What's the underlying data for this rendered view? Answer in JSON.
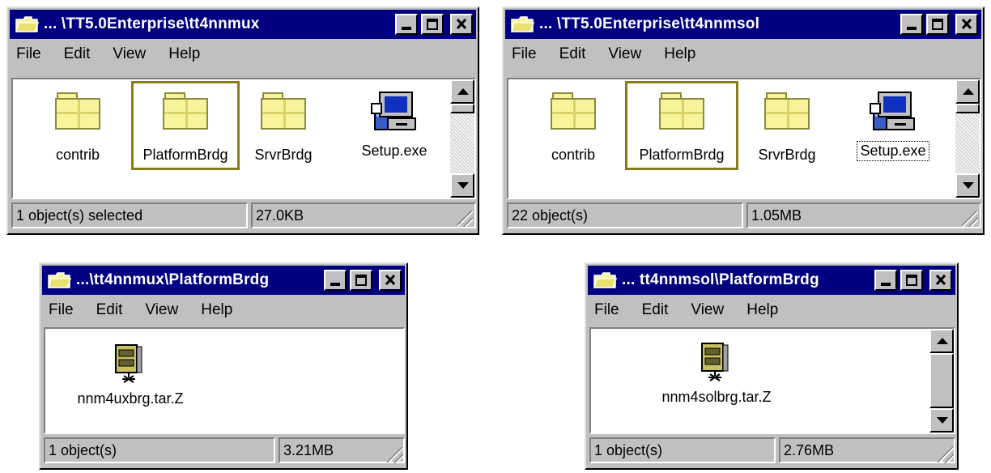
{
  "menu": {
    "file": "File",
    "edit": "Edit",
    "view": "View",
    "help": "Help"
  },
  "windows": [
    {
      "title": "... \\TT5.0Enterprise\\tt4nnmux",
      "items": [
        "contrib",
        "PlatformBrdg",
        "SrvrBrdg",
        "Setup.exe"
      ],
      "status": {
        "left": "1 object(s) selected",
        "right": "27.0KB"
      }
    },
    {
      "title": "... \\TT5.0Enterprise\\tt4nnmsol",
      "items": [
        "contrib",
        "PlatformBrdg",
        "SrvrBrdg",
        "Setup.exe"
      ],
      "status": {
        "left": "22 object(s)",
        "right": "1.05MB"
      }
    },
    {
      "title": "...\\tt4nnmux\\PlatformBrdg",
      "items": [
        "nnm4uxbrg.tar.Z"
      ],
      "status": {
        "left": "1 object(s)",
        "right": "3.21MB"
      }
    },
    {
      "title": "... tt4nnmsol\\PlatformBrdg",
      "items": [
        "nnm4solbrg.tar.Z"
      ],
      "status": {
        "left": "1 object(s)",
        "right": "2.76MB"
      }
    }
  ],
  "icons": {
    "folder": "folder-icon",
    "setup": "setup-installer-icon",
    "archive": "compressed-archive-icon"
  },
  "colors": {
    "titlebar": "#000080",
    "window": "#c0c0c0",
    "selection_box": "#8b7a18"
  }
}
